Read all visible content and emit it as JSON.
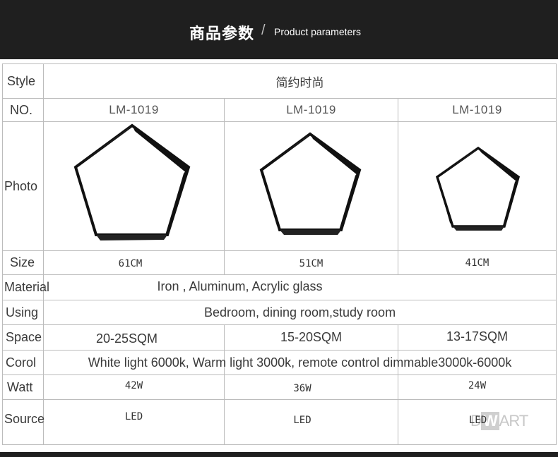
{
  "header": {
    "title_cn": "商品参数",
    "separator": "/",
    "title_en": "Product parameters"
  },
  "rows": {
    "style": {
      "label": "Style",
      "value": "简约时尚"
    },
    "no": {
      "label": "NO.",
      "values": [
        "LM-1019",
        "LM-1019",
        "LM-1019"
      ]
    },
    "photo": {
      "label": "Photo",
      "items": [
        "pentagon-lamp-large",
        "pentagon-lamp-medium",
        "pentagon-lamp-small"
      ]
    },
    "size": {
      "label": "Size",
      "values": [
        "61CM",
        "51CM",
        "41CM"
      ]
    },
    "material": {
      "label": "Material",
      "value": "Iron , Aluminum, Acrylic glass"
    },
    "using": {
      "label": "Using",
      "value": "Bedroom, dining room,study room"
    },
    "space": {
      "label": "Space",
      "values": [
        "20-25SQM",
        "15-20SQM",
        "13-17SQM"
      ]
    },
    "corol": {
      "label": "Corol",
      "value": "White light 6000k, Warm light 3000k, remote control dimmable3000k-6000k"
    },
    "watt": {
      "label": "Watt",
      "values": [
        "42W",
        "36W",
        "24W"
      ]
    },
    "source": {
      "label": "Source",
      "values": [
        "LED",
        "LED",
        "LED"
      ]
    }
  },
  "watermark": {
    "left": "D",
    "mid": "W",
    "right": "ART"
  },
  "colors": {
    "header_bg": "#1f1f1f",
    "grid": "#bcbcbc",
    "lamp": "#111111"
  }
}
